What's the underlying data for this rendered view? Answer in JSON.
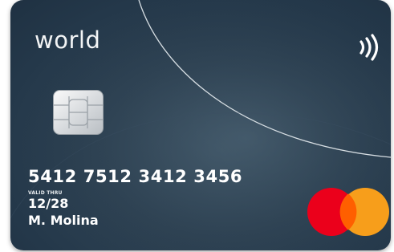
{
  "card": {
    "brand": "world",
    "number": "5412 7512 3412 3456",
    "valid_thru_label": "VALID THRU",
    "expiry": "12/28",
    "holder_name": "M. Molina",
    "network": "mastercard-logo",
    "contactless_icon": "contactless-icon",
    "chip_icon": "emv-chip-icon"
  },
  "colors": {
    "card_background": "#2a3d4e",
    "network_red": "#eb001b",
    "network_orange": "#f79e1b",
    "network_overlap": "#ff5f00",
    "text": "#ffffff"
  }
}
